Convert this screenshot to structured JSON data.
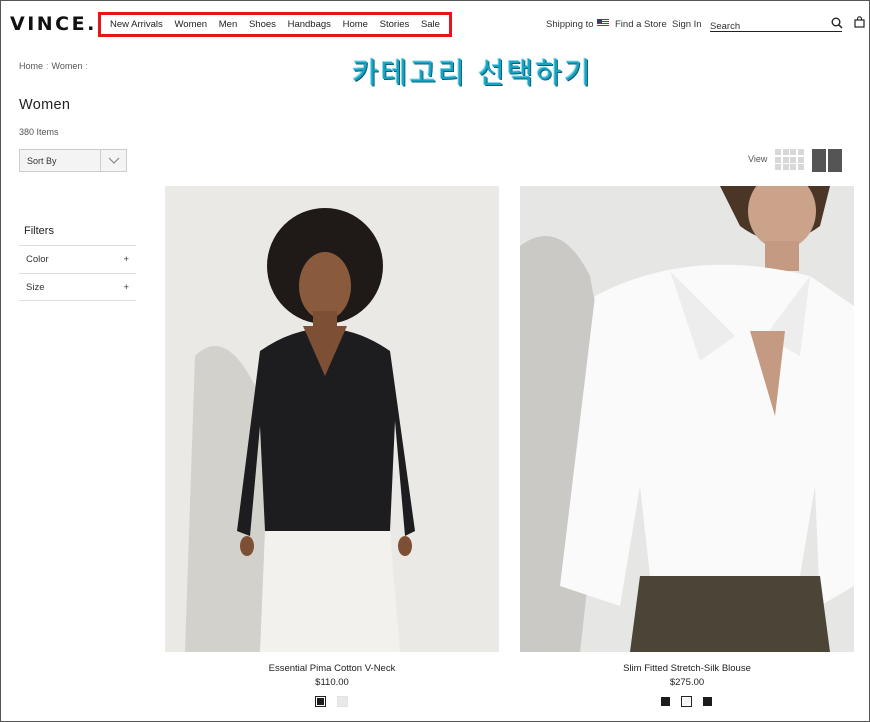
{
  "brand": {
    "logo_text": "VINCE."
  },
  "nav": {
    "items": [
      "New Arrivals",
      "Women",
      "Men",
      "Shoes",
      "Handbags",
      "Home",
      "Stories",
      "Sale"
    ],
    "highlight_color": "#e8141b"
  },
  "utility": {
    "shipping_label": "Shipping to",
    "find_store": "Find a Store",
    "sign_in": "Sign In",
    "search_placeholder": "Search"
  },
  "overlay_text": "카테고리 선택하기",
  "breadcrumb": [
    "Home",
    "Women"
  ],
  "page": {
    "title": "Women",
    "item_count": "380 Items"
  },
  "sort": {
    "label": "Sort By"
  },
  "view": {
    "label": "View"
  },
  "filters": {
    "title": "Filters",
    "items": [
      "Color",
      "Size"
    ],
    "toggle": "+"
  },
  "products": [
    {
      "name": "Essential Pima Cotton V-Neck",
      "price": "$110.00",
      "swatches": [
        "#1c1c1c",
        "#e9e9e9"
      ]
    },
    {
      "name": "Slim Fitted Stretch-Silk Blouse",
      "price": "$275.00",
      "swatches": [
        "#1c1c1c",
        "#f4f4f4",
        "#1c1c1c"
      ]
    }
  ],
  "icons": [
    "search-icon",
    "bag-icon",
    "chevron-down-icon",
    "flag-us-icon"
  ]
}
